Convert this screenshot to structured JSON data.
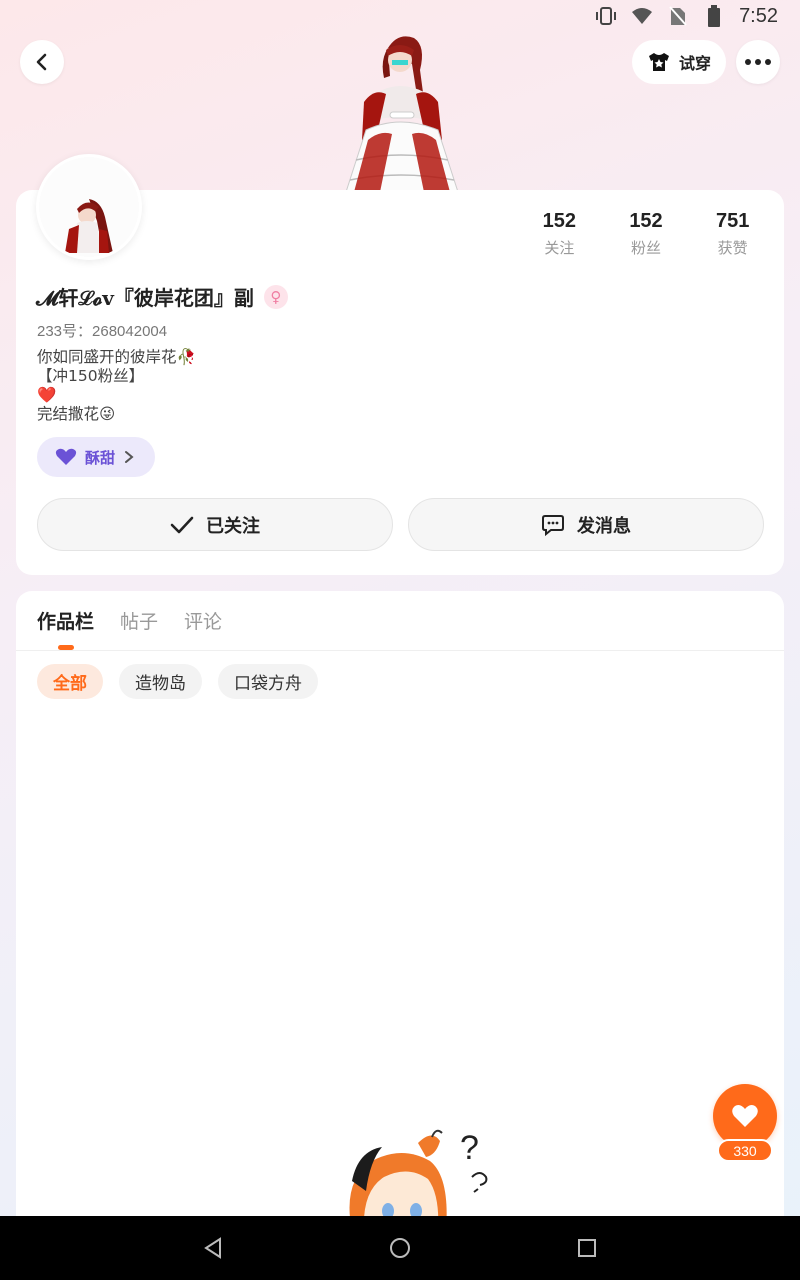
{
  "status_bar": {
    "time": "7:52"
  },
  "header": {
    "tryon_label": "试穿"
  },
  "profile": {
    "username": "𝓜轩ℒ𝓸v『彼岸花团』副",
    "gender_symbol": "♀",
    "uid": "233号：268042004",
    "bio_lines": [
      "你如同盛开的彼岸花🥀",
      "【冲150粉丝】",
      "❤️",
      "完结撒花😜"
    ],
    "stats": [
      {
        "value": "152",
        "label": "关注"
      },
      {
        "value": "152",
        "label": "粉丝"
      },
      {
        "value": "751",
        "label": "获赞"
      }
    ],
    "level_badge": {
      "label": "酥甜",
      "icon": "purple-heart-icon",
      "color": "#6b52d6"
    }
  },
  "actions": {
    "follow_label": "已关注",
    "message_label": "发消息"
  },
  "works": {
    "tabs": [
      {
        "label": "作品栏",
        "active": true
      },
      {
        "label": "帖子",
        "active": false
      },
      {
        "label": "评论",
        "active": false
      }
    ],
    "filters": [
      {
        "label": "全部",
        "active": true
      },
      {
        "label": "造物岛",
        "active": false
      },
      {
        "label": "口袋方舟",
        "active": false
      }
    ]
  },
  "like_fab": {
    "count": "330",
    "color": "#ff6a1a"
  }
}
